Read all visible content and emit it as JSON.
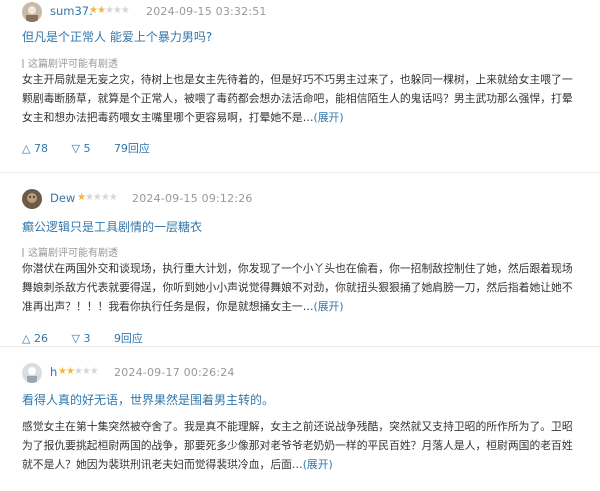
{
  "reviews": [
    {
      "username": "sum37.",
      "stars": 2,
      "date": "2024-09-15 03:32:51",
      "title": "但凡是个正常人 能爱上个暴力男吗?",
      "spoiler": "这篇剧评可能有剧透",
      "lines": [
        "女主开局就是无妄之灾，待树上也是女主先待着的，但是好巧不巧男主过来了，也躲同一棵树，上来就给女主喂了一",
        "颗剧毒断肠草，就算是个正常人，被喂了毒药都会想办法活命吧，能相信陌生人的鬼话吗？男主武功那么强悍，打晕",
        "女主和想办法把毒药喂女主嘴里哪个更容易啊，打晕她不是…"
      ],
      "expand": "(展开)",
      "upvotes": "78",
      "downvotes": "5",
      "replies": "79回应"
    },
    {
      "username": "Dew",
      "stars": 1,
      "date": "2024-09-15 09:12:26",
      "title": "癫公逻辑只是工具剧情的一层糖衣",
      "spoiler": "这篇剧评可能有剧透",
      "lines": [
        "你潜伏在两国外交和谈现场，执行重大计划，你发现了一个小丫头也在偷看，你一招制敌控制住了她，然后跟着现场",
        "舞娘刺杀敌方代表就要得逞，你听到她小小声说觉得舞娘不对劲，你就扭头狠狠捅了她肩膀一刀，然后指着她让她不",
        "准再出声？！！！我看你执行任务是假，你是就想捅女主一…"
      ],
      "expand": "(展开)",
      "upvotes": "26",
      "downvotes": "3",
      "replies": "9回应"
    },
    {
      "username": "h",
      "stars": 2,
      "date": "2024-09-17 00:26:24",
      "title": "看得人真的好无语，世界果然是围着男主转的。",
      "lines": [
        "感觉女主在第十集突然被夺舍了。我是真不能理解，女主之前还说战争残酷，突然就又支持卫昭的所作所为了。卫昭",
        "为了报仇要挑起桓尉两国的战争，那要死多少像那对老爷爷老奶奶一样的平民百姓？月落人是人，桓尉两国的老百姓",
        "就不是人？她因为裴珙刑讯老夫妇而觉得裴珙冷血，后面…"
      ],
      "expand": "(展开)"
    }
  ],
  "colors": {
    "link": "#3377aa",
    "star": "#f4b73a",
    "star_off": "#d6d6d6",
    "meta": "#999999"
  },
  "icons": {
    "upvote": "triangle-up-icon",
    "downvote": "triangle-down-icon"
  }
}
